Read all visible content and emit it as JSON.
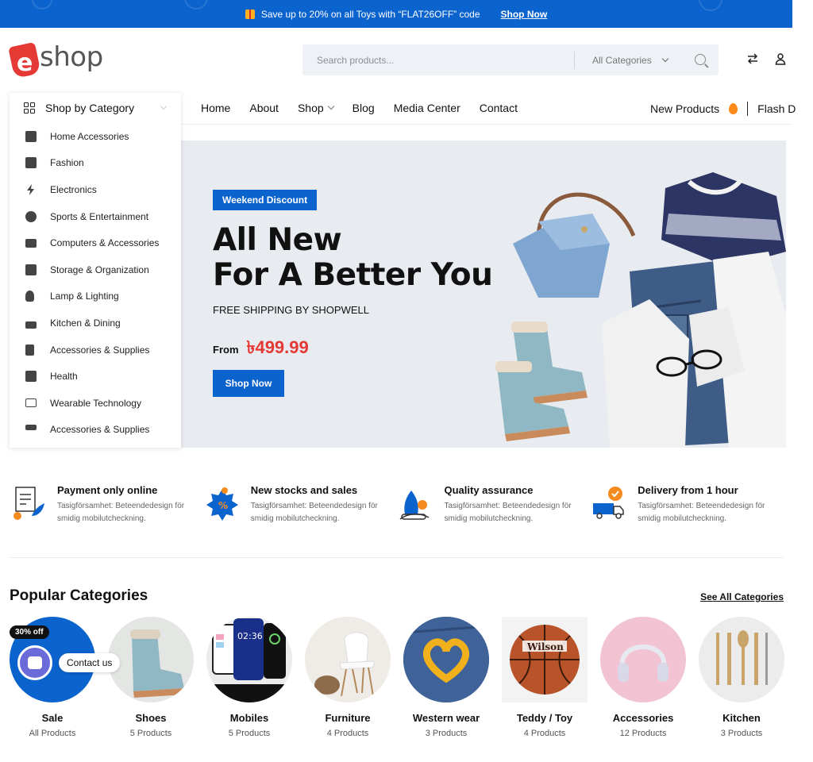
{
  "promo": {
    "text": "Save up to 20% on all Toys with “FLAT26OFF” code",
    "link": "Shop Now"
  },
  "header": {
    "logo_text": "shop",
    "search_placeholder": "Search products...",
    "category_select": "All Categories"
  },
  "category_panel": {
    "title": "Shop by Category",
    "items": [
      {
        "label": "Home Accessories",
        "icon": "home-accessories-icon"
      },
      {
        "label": "Fashion",
        "icon": "fashion-icon"
      },
      {
        "label": "Electronics",
        "icon": "lightning-icon"
      },
      {
        "label": "Sports & Entertainment",
        "icon": "ball-icon"
      },
      {
        "label": "Computers & Accessories",
        "icon": "monitor-icon"
      },
      {
        "label": "Storage & Organization",
        "icon": "storage-box-icon"
      },
      {
        "label": "Lamp & Lighting",
        "icon": "bulb-icon"
      },
      {
        "label": "Kitchen & Dining",
        "icon": "kitchen-icon"
      },
      {
        "label": "Accessories & Supplies",
        "icon": "calculator-icon"
      },
      {
        "label": "Health",
        "icon": "medical-kit-icon"
      },
      {
        "label": "Wearable Technology",
        "icon": "laptop-icon"
      },
      {
        "label": "Accessories & Supplies",
        "icon": "paint-roller-icon"
      }
    ]
  },
  "nav": {
    "items": [
      "Home",
      "About",
      "Shop",
      "Blog",
      "Media Center",
      "Contact"
    ],
    "new_products": "New Products",
    "flash": "Flash D"
  },
  "hero": {
    "badge": "Weekend Discount",
    "headline_1": "All New",
    "headline_2": "For A Better You",
    "subline": "FREE SHIPPING BY SHOPWELL",
    "from_label": "From",
    "price": "৳499.99",
    "button": "Shop Now"
  },
  "features": [
    {
      "title": "Payment only online",
      "desc": "Tasigförsamhet: Beteendedesign för smidig mobilutcheckning.",
      "icon": "payment-icon"
    },
    {
      "title": "New stocks and sales",
      "desc": "Tasigförsamhet: Beteendedesign för smidig mobilutcheckning.",
      "icon": "sale-tag-icon"
    },
    {
      "title": "Quality assurance",
      "desc": "Tasigförsamhet: Beteendedesign för smidig mobilutcheckning.",
      "icon": "quality-icon"
    },
    {
      "title": "Delivery from 1 hour",
      "desc": "Tasigförsamhet: Beteendedesign för smidig mobilutcheckning.",
      "icon": "delivery-truck-icon"
    }
  ],
  "popular": {
    "title": "Popular Categories",
    "see_all": "See All Categories",
    "badge": "30% off",
    "items": [
      {
        "name": "Sale",
        "count": "All Products"
      },
      {
        "name": "Shoes",
        "count": "5 Products"
      },
      {
        "name": "Mobiles",
        "count": "5 Products"
      },
      {
        "name": "Furniture",
        "count": "4 Products"
      },
      {
        "name": "Western wear",
        "count": "3 Products"
      },
      {
        "name": "Teddy / Toy",
        "count": "4 Products"
      },
      {
        "name": "Accessories",
        "count": "12 Products"
      },
      {
        "name": "Kitchen",
        "count": "3 Products"
      }
    ]
  },
  "contact_widget": {
    "label": "Contact us"
  },
  "colors": {
    "brand_blue": "#0b63ce",
    "price_red": "#e53935",
    "logo_red": "#e53935"
  }
}
